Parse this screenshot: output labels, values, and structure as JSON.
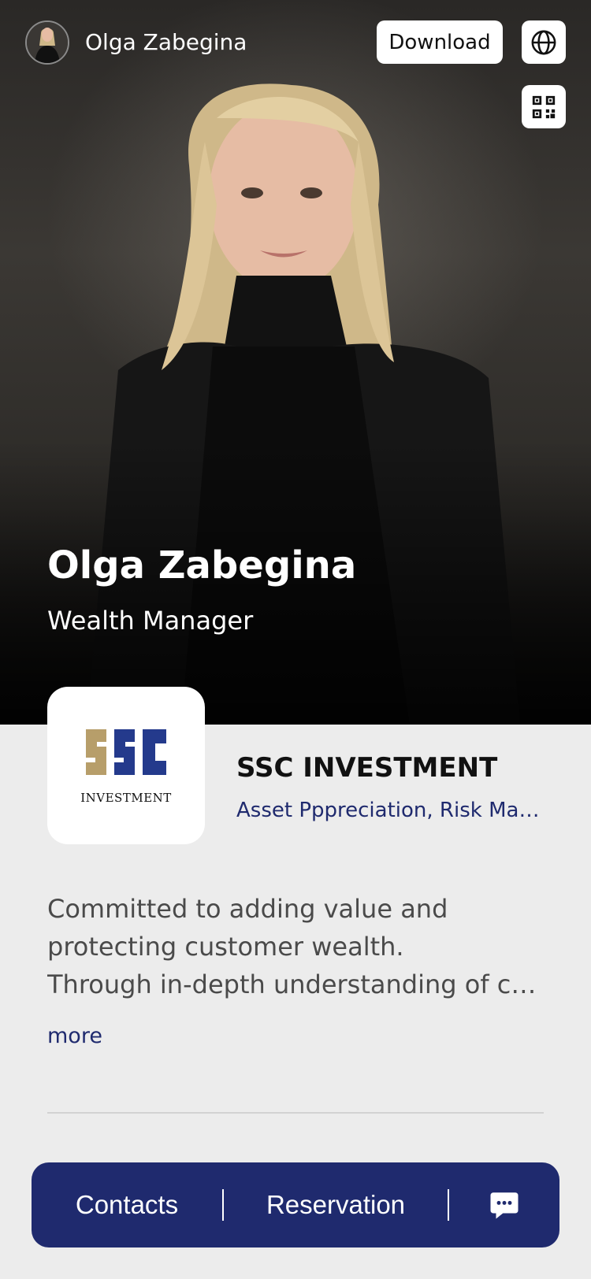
{
  "topbar": {
    "avatar": "avatar",
    "name": "Olga Zabegina",
    "download_label": "Download",
    "globe_icon": "globe-icon",
    "qr_icon": "qr-code-icon"
  },
  "hero": {
    "name": "Olga Zabegina",
    "title": "Wealth Manager"
  },
  "company": {
    "logo_text": "INVESTMENT",
    "logo_mark": "SSC",
    "name": "SSC INVESTMENT",
    "tags": "Asset Pppreciation, Risk Management"
  },
  "description": {
    "line1": "Committed to adding value and",
    "line2": "protecting customer wealth.",
    "line3": "Through in-depth understanding of customer needs",
    "more_label": "more"
  },
  "actions": {
    "contacts_label": "Contacts",
    "reservation_label": "Reservation",
    "chat_icon": "chat-icon"
  },
  "colors": {
    "brand": "#1f2a6e",
    "logo_gold": "#b79e6a",
    "logo_blue": "#243a8c",
    "page_bg": "#ececec"
  }
}
